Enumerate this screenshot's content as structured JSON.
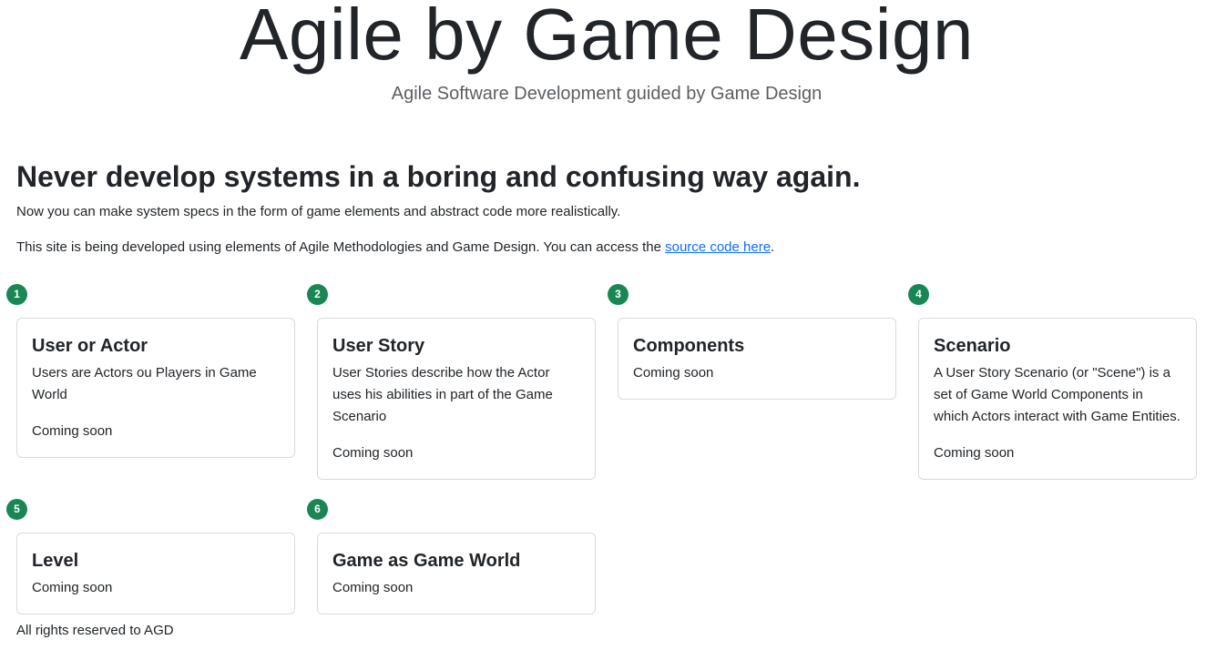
{
  "hero": {
    "title": "Agile by Game Design",
    "subtitle": "Agile Software Development guided by Game Design"
  },
  "intro": {
    "headline": "Never develop systems in a boring and confusing way again.",
    "lead": "Now you can make system specs in the form of game elements and abstract code more realistically.",
    "info_prefix": "This site is being developed using elements of Agile Methodologies and Game Design. You can access the ",
    "info_link": "source code here",
    "info_suffix": "."
  },
  "cards": [
    {
      "number": "1",
      "title": "User or Actor",
      "description": "Users are Actors ou Players in Game World",
      "status": "Coming soon"
    },
    {
      "number": "2",
      "title": "User Story",
      "description": "User Stories describe how the Actor uses his abilities in part of the Game Scenario",
      "status": "Coming soon"
    },
    {
      "number": "3",
      "title": "Components",
      "description": "",
      "status": "Coming soon"
    },
    {
      "number": "4",
      "title": "Scenario",
      "description": "A User Story Scenario (or \"Scene\") is a set of Game World Components in which Actors interact with Game Entities.",
      "status": "Coming soon"
    },
    {
      "number": "5",
      "title": "Level",
      "description": "",
      "status": "Coming soon"
    },
    {
      "number": "6",
      "title": "Game as Game World",
      "description": "",
      "status": "Coming soon"
    }
  ],
  "footer": {
    "text": "All rights reserved to AGD"
  },
  "colors": {
    "badge": "#198754",
    "link": "#0d6efd",
    "text": "#212529",
    "border": "#d8dbde"
  }
}
